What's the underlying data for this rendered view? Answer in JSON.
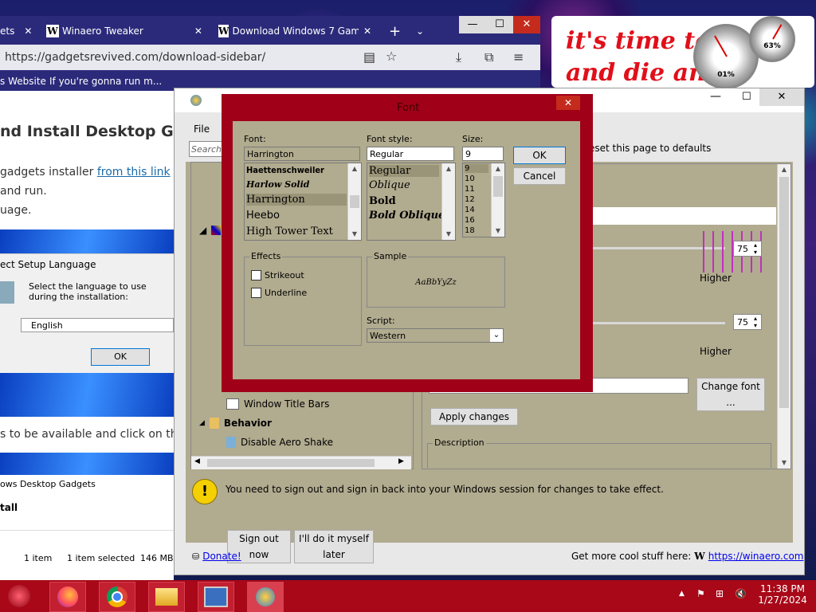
{
  "browser": {
    "tabs": [
      {
        "label": "ets",
        "favicon": ""
      },
      {
        "label": "Winaero Tweaker",
        "favicon": "W"
      },
      {
        "label": "Download Windows 7 Game",
        "favicon": "W"
      }
    ],
    "url": "https://gadgetsrevived.com/download-sidebar/",
    "bookmarks": [
      "s Website",
      "If you're gonna run m..."
    ]
  },
  "page": {
    "heading": "nd Install Desktop Ga",
    "line1_prefix": "gadgets installer ",
    "line1_link": "from this link",
    "line2": "and run.",
    "line3": "uage.",
    "setup_title": "ect Setup Language",
    "setup_text": "Select the language to use during the installation:",
    "setup_language": "English",
    "setup_ok": "OK",
    "line4": "s to be available and click on th",
    "gadgets_title": "ows Desktop Gadgets",
    "install": "tall",
    "status_items": "1 item",
    "status_selected": "1 item selected",
    "status_size": "146 MB"
  },
  "widget": {
    "text_line1": "it's time to",
    "text_line2": "and die and c  brate",
    "gauge_cpu": "01%",
    "gauge_mem": "63%"
  },
  "tweaker": {
    "menu_file": "File",
    "search_placeholder": "Search",
    "reset_link": "eset this page to defaults",
    "tree": {
      "window_title_bars": "Window Title Bars",
      "behavior": "Behavior",
      "disable_aero_shake": "Disable Aero Shake"
    },
    "slider1_value": "75",
    "slider2_value": "75",
    "higher1": "Higher",
    "higher2": "Higher",
    "font_preview": "♋♏■ ⌧◻■♦ ♎♋■●♏",
    "change_font": "Change font ...",
    "apply_changes": "Apply changes",
    "description": "Description",
    "notice": "You need to sign out and sign in back into your Windows session for changes to take effect.",
    "sign_out_now": "Sign out now",
    "do_myself": "I'll do it myself later",
    "donate": "Donate!",
    "more_stuff": "Get more cool stuff here:",
    "winaero_link": "https://winaero.com"
  },
  "font_dialog": {
    "title": "Font",
    "font_label": "Font:",
    "font_value": "Harrington",
    "fonts": [
      "Haettenschweiler",
      "Harlow Solid",
      "Harrington",
      "Heebo",
      "High Tower Text"
    ],
    "style_label": "Font style:",
    "style_value": "Regular",
    "styles": [
      "Regular",
      "Oblique",
      "Bold",
      "Bold Oblique"
    ],
    "size_label": "Size:",
    "size_value": "9",
    "sizes": [
      "9",
      "10",
      "11",
      "12",
      "14",
      "16",
      "18"
    ],
    "ok": "OK",
    "cancel": "Cancel",
    "effects_label": "Effects",
    "strikeout": "Strikeout",
    "underline": "Underline",
    "sample_label": "Sample",
    "sample_text": "AaBbYyZz",
    "script_label": "Script:",
    "script_value": "Western"
  },
  "taskbar": {
    "time": "11:38 PM",
    "date": "1/27/2024"
  },
  "colors": {
    "dialog_frame": "#a00018",
    "client_bg": "#b1ab8f",
    "taskbar": "#a80818"
  }
}
